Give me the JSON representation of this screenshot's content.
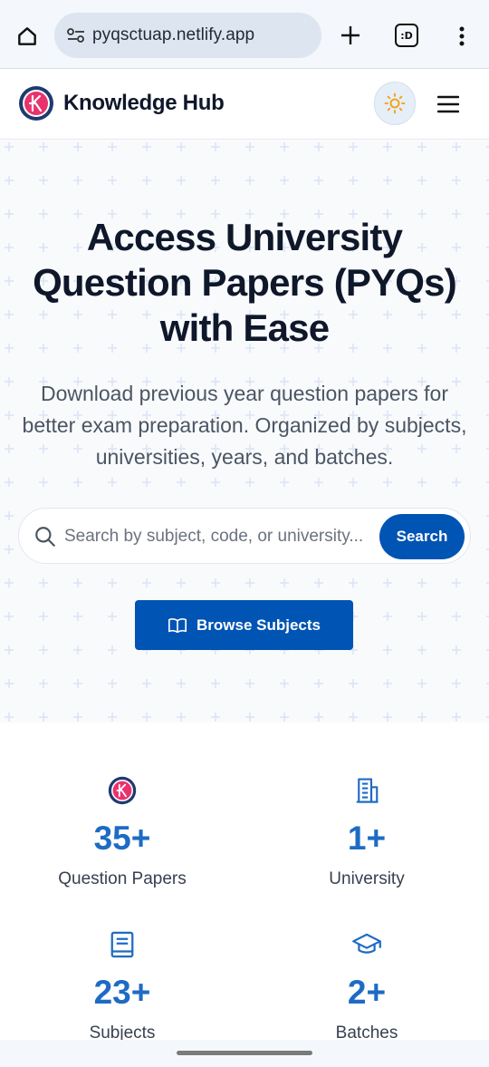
{
  "browser": {
    "url": "pyqsctuap.netlify.app",
    "tab_count_label": ":D"
  },
  "header": {
    "brand": "Knowledge Hub"
  },
  "hero": {
    "title_line1": "Access University",
    "title_line2": "Question Papers (PYQs)",
    "title_line3": "with Ease",
    "subtitle": "Download previous year question papers for better exam preparation. Organized by subjects, universities, years, and batches.",
    "search_placeholder": "Search by subject, code, or university...",
    "search_button": "Search",
    "browse_button": "Browse Subjects"
  },
  "stats": [
    {
      "value": "35+",
      "label": "Question Papers",
      "icon": "logo-icon"
    },
    {
      "value": "1+",
      "label": "University",
      "icon": "building-icon"
    },
    {
      "value": "23+",
      "label": "Subjects",
      "icon": "book-icon"
    },
    {
      "value": "2+",
      "label": "Batches",
      "icon": "graduation-cap-icon"
    }
  ],
  "colors": {
    "primary": "#0054b4",
    "stat_number": "#1e6bc4",
    "logo_pink": "#e8336d",
    "logo_navy": "#1e3a70"
  }
}
